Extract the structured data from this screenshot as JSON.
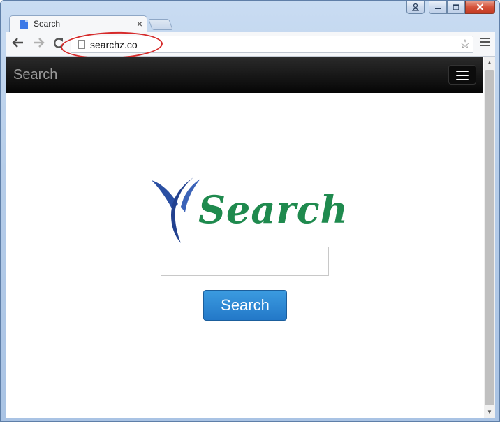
{
  "window": {
    "controls": {
      "user": "user-icon",
      "minimize": "minimize-icon",
      "maximize": "maximize-icon",
      "close": "close-icon"
    }
  },
  "tabs": [
    {
      "title": "Search",
      "close": "×"
    }
  ],
  "toolbar": {
    "url": "searchz.co"
  },
  "site": {
    "brand": "Search",
    "logo_text": "Search",
    "search_placeholder": "",
    "search_value": "",
    "search_button": "Search"
  },
  "colors": {
    "nav_bg": "#0d0d0d",
    "brand_text": "#9a9a9a",
    "logo_green": "#1f8a4e",
    "logo_blue": "#2a4fa3",
    "button_blue": "#2a86d4",
    "annotation_red": "#d62a2a"
  }
}
